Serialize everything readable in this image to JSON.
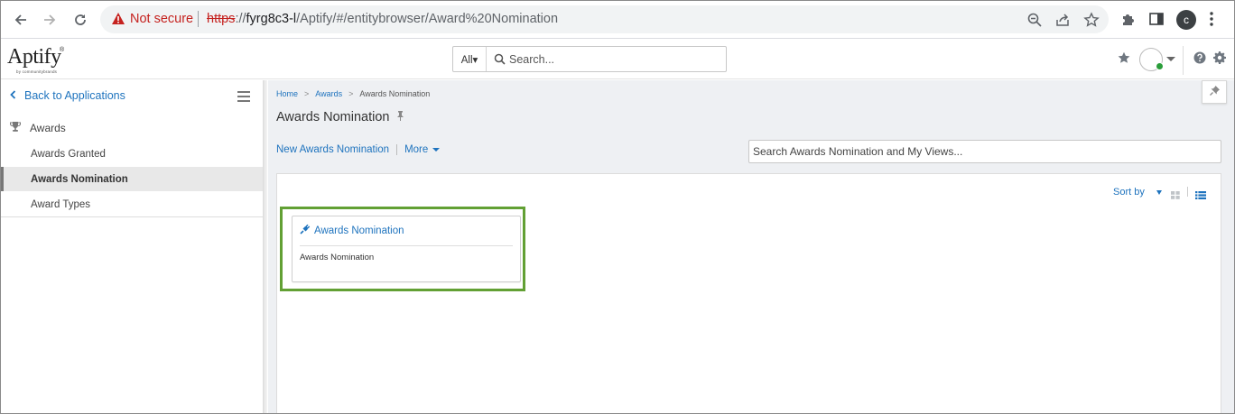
{
  "browser": {
    "security_label": "Not secure",
    "url_protocol": "https",
    "url_sep": "://",
    "url_host": "fyrg8c3-l",
    "url_path": "/Aptify/#/entitybrowser/Award%20Nomination",
    "profile_initial": "c"
  },
  "header": {
    "logo_name": "Aptify",
    "logo_tm": "®",
    "logo_sub": "by communitybrands",
    "search_scope": "All▾",
    "search_placeholder": "Search..."
  },
  "sidebar": {
    "back_label": "Back to Applications",
    "group_label": "Awards",
    "items": [
      {
        "label": "Awards Granted",
        "active": false
      },
      {
        "label": "Awards Nomination",
        "active": true
      },
      {
        "label": "Award Types",
        "active": false
      }
    ]
  },
  "main": {
    "breadcrumb": [
      {
        "label": "Home"
      },
      {
        "label": "Awards"
      },
      {
        "label": "Awards Nomination"
      }
    ],
    "breadcrumb_sep": ">",
    "title": "Awards Nomination",
    "new_action": "New Awards Nomination",
    "more_action": "More",
    "view_search_placeholder": "Search Awards Nomination and My Views...",
    "sort_label": "Sort by",
    "card": {
      "title": "Awards Nomination",
      "body": "Awards Nomination"
    }
  },
  "colors": {
    "link": "#1e73be",
    "highlight": "#62a034",
    "warning": "#c5221f"
  }
}
